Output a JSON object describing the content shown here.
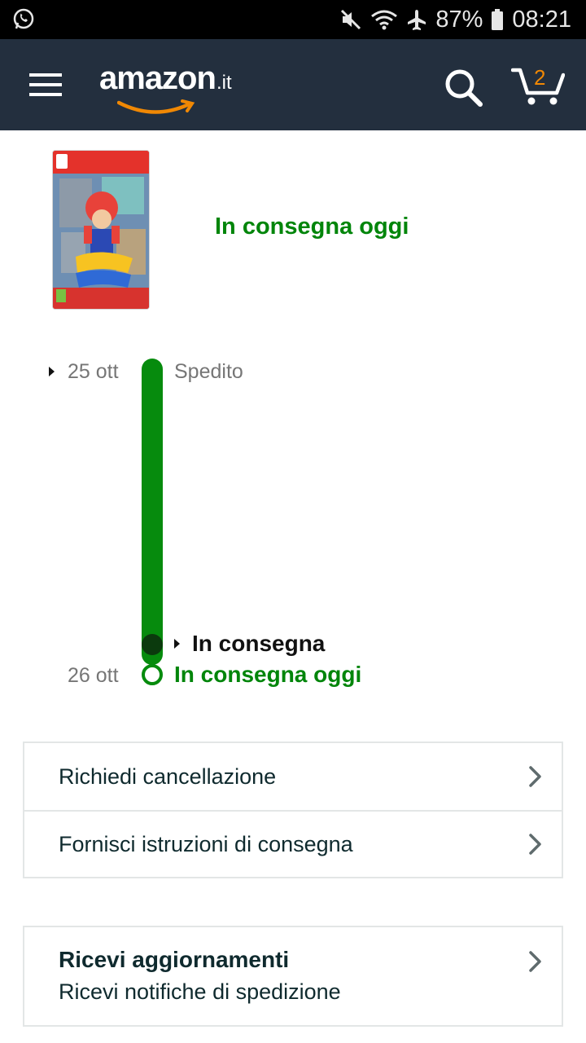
{
  "status_bar": {
    "battery": "87%",
    "time": "08:21"
  },
  "header": {
    "logo_word": "amazon",
    "logo_tld": ".it",
    "cart_count": "2"
  },
  "product": {
    "status": "In consegna oggi"
  },
  "timeline": {
    "shipped_date": "25 ott",
    "shipped_label": "Spedito",
    "current_label": "In consegna",
    "delivery_date": "26 ott",
    "delivery_label": "In consegna oggi"
  },
  "actions": {
    "cancel_label": "Richiedi cancellazione",
    "instructions_label": "Fornisci istruzioni di consegna"
  },
  "updates": {
    "title": "Ricevi aggiornamenti",
    "subtitle": "Ricevi notifiche di spedizione"
  },
  "colors": {
    "header_bg": "#232f3e",
    "green": "#00850a",
    "cart_badge": "#f08804"
  }
}
